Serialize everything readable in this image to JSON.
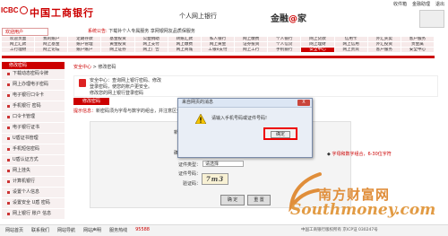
{
  "header": {
    "logo_en": "ICBC",
    "logo_cn": "中国工商银行",
    "sub_title": "个人网上银行",
    "brand_prefix": "金融",
    "brand_at": "@",
    "brand_suffix": "家",
    "top_links": [
      "收件箱",
      "金融助理",
      "退出"
    ]
  },
  "user_tab": "欢迎用户",
  "notice": {
    "label": "系统公告:",
    "text": "下载补个人专属服务 享网银网友品质保服务"
  },
  "nav": {
    "rows": [
      [
        "欢迎页面",
        "我的账户",
        "定期存款",
        "基金投资",
        "公益捐助",
        "转账汇款",
        "私人银行",
        "网上缴费",
        "个人银行",
        "网上贷款",
        "信用卡",
        "外汇买卖",
        "客户服务"
      ],
      [
        "网上汇款",
        "网上基金",
        "账户管理",
        "黄金投资",
        "网上支付",
        "网上缴费",
        "网上黄金",
        "证券投资",
        "个人信贷",
        "网上理财",
        "网上信用",
        "外汇投资",
        "贵金属"
      ],
      [
        "工行理财",
        "网上论坛",
        "账户账户",
        "网上证券",
        "网上广告",
        "网上商城",
        "工银e支付",
        "网上工行",
        "手机银行",
        "安全中心",
        "网上贵宾",
        "客户服务",
        "安全中心"
      ]
    ]
  },
  "sidebar": {
    "head": "修改密码",
    "items": [
      "下载动态密码令牌",
      "网上办理电子密码",
      "电子银行口令卡",
      "手机银行 密码",
      "口令卡管理",
      "电子银行证书",
      "U盾证书管理",
      "手机短信密码",
      "U盾认证方式",
      "网上挂失",
      "计算机银行",
      "设置个人信息",
      "设置安全 U盾 密码",
      "网上银行 账户 信息"
    ]
  },
  "crumb": {
    "home": "安全中心",
    "current": "修改密码"
  },
  "info": {
    "line1": "安全中心：查询网上银行密码、修改",
    "line2": "登录密码，使您的账户更安全。",
    "line3": "修改您的网上银行登录密码"
  },
  "modify_tab": "修改密码",
  "tip": {
    "prefix": "提示信息：",
    "text": "新密码须为字母与数字的组合，并注意区分大小写"
  },
  "form": {
    "new_pwd_label": "新登录密码：",
    "confirm_label": "确认新密码：",
    "id_type_label": "证件类型：",
    "id_type_value": "请选择",
    "id_no_label": "证件号码：",
    "captcha_label": "验证码：",
    "captcha_value": "7m3",
    "confirm_btn": "确 定",
    "reset_btn": "重 置",
    "hint_right": "字母和数字组合，6-30位字符"
  },
  "dialog": {
    "title": "来自网页的消息",
    "close": "X",
    "message": "请输入手机号码或证件号码!",
    "ok": "确定"
  },
  "footer": {
    "links": [
      "网站首页",
      "联系我们",
      "网站导航",
      "网站声明",
      "服务热线",
      "95588"
    ],
    "copy": "中国工商银行版权所有 京ICP证 030247号"
  },
  "watermark": {
    "cn": "南方财富网",
    "en": "Southmoney.com"
  }
}
